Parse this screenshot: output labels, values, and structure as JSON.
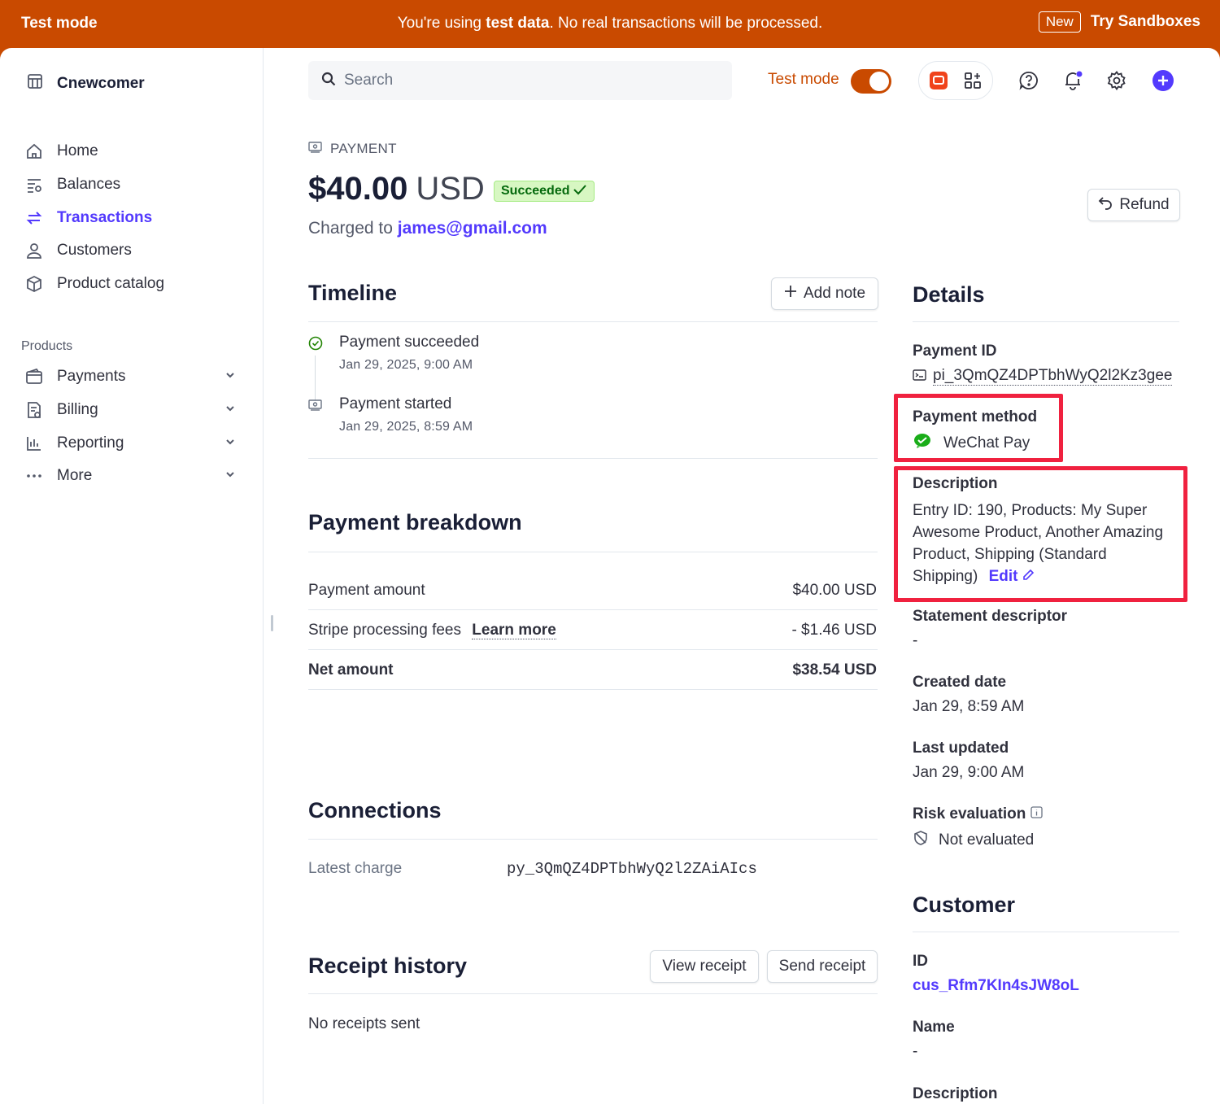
{
  "banner": {
    "left": "Test mode",
    "center_pre": "You're using ",
    "center_bold": "test data",
    "center_post": ". No real transactions will be processed.",
    "new_badge": "New",
    "sandbox": "Try Sandboxes"
  },
  "sidebar": {
    "account": "Cnewcomer",
    "items": [
      {
        "label": "Home",
        "icon": "home-icon"
      },
      {
        "label": "Balances",
        "icon": "balances-icon"
      },
      {
        "label": "Transactions",
        "icon": "transactions-icon",
        "active": true
      },
      {
        "label": "Customers",
        "icon": "customers-icon"
      },
      {
        "label": "Product catalog",
        "icon": "box-icon"
      }
    ],
    "section": "Products",
    "product_items": [
      {
        "label": "Payments",
        "icon": "wallet-icon"
      },
      {
        "label": "Billing",
        "icon": "billing-icon"
      },
      {
        "label": "Reporting",
        "icon": "bar-chart-icon"
      },
      {
        "label": "More",
        "icon": "more-icon"
      }
    ]
  },
  "header": {
    "search_placeholder": "Search",
    "test_mode": "Test mode"
  },
  "payment": {
    "kicker": "PAYMENT",
    "amount": "$40.00",
    "currency": "USD",
    "status": "Succeeded",
    "charged_prefix": "Charged to ",
    "email": "james@gmail.com",
    "refund": "Refund"
  },
  "timeline": {
    "title": "Timeline",
    "add_note": "Add note",
    "events": [
      {
        "title": "Payment succeeded",
        "date": "Jan 29, 2025, 9:00 AM"
      },
      {
        "title": "Payment started",
        "date": "Jan 29, 2025, 8:59 AM"
      }
    ]
  },
  "breakdown": {
    "title": "Payment breakdown",
    "rows": [
      {
        "label": "Payment amount",
        "value": "$40.00 USD"
      },
      {
        "label": "Stripe processing fees",
        "link": "Learn more",
        "value": "- $1.46 USD"
      },
      {
        "label": "Net amount",
        "value": "$38.54 USD"
      }
    ]
  },
  "connections": {
    "title": "Connections",
    "label": "Latest charge",
    "value": "py_3QmQZ4DPTbhWyQ2l2ZAiAIcs"
  },
  "receipts": {
    "title": "Receipt history",
    "view": "View receipt",
    "send": "Send receipt",
    "empty": "No receipts sent"
  },
  "details": {
    "title": "Details",
    "payment_id_label": "Payment ID",
    "payment_id": "pi_3QmQZ4DPTbhWyQ2l2Kz3gee",
    "method_label": "Payment method",
    "method": "WeChat Pay",
    "description_label": "Description",
    "description_lines": [
      "Entry ID: 190, Products: My Super",
      "Awesome Product, Another Amazing",
      "Product, Shipping (Standard",
      "Shipping)"
    ],
    "edit": "Edit",
    "statement_label": "Statement descriptor",
    "statement": "-",
    "created_label": "Created date",
    "created": "Jan 29, 8:59 AM",
    "updated_label": "Last updated",
    "updated": "Jan 29, 9:00 AM",
    "risk_label": "Risk evaluation",
    "risk": "Not evaluated"
  },
  "customer": {
    "title": "Customer",
    "id_label": "ID",
    "id": "cus_Rfm7KIn4sJW8oL",
    "name_label": "Name",
    "name": "-",
    "description_label": "Description"
  },
  "colors": {
    "accent": "#533afd",
    "test_orange": "#c94a00",
    "success_bg": "#d7f7c2",
    "highlight": "#f0213f"
  }
}
